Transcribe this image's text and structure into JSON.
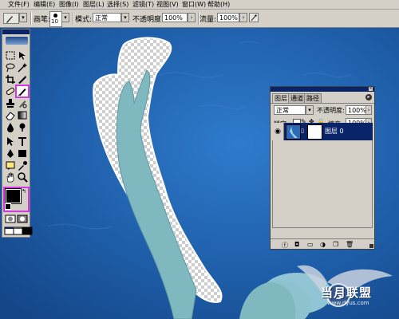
{
  "menu": {
    "items": [
      "文件(F)",
      "编辑(E)",
      "图像(I)",
      "图层(L)",
      "选择(S)",
      "滤镜(T)",
      "视图(V)",
      "窗口(W)",
      "帮助(H)"
    ]
  },
  "options": {
    "brush_label": "画笔:",
    "brush_size": "10",
    "mode_label": "模式:",
    "mode_value": "正常",
    "opacity_label": "不透明度:",
    "opacity_value": "100%",
    "flow_label": "流量:",
    "flow_value": "100%"
  },
  "layers_panel": {
    "tabs": [
      "图层",
      "通道",
      "路径"
    ],
    "blend_mode": "正常",
    "opacity_label": "不透明度:",
    "opacity_value": "100%",
    "lock_label": "锁定:",
    "fill_label": "填充:",
    "fill_value": "100%",
    "layer_name": "图层 0"
  },
  "watermark": {
    "text": "当月联盟",
    "url": "www.dyus.com"
  },
  "colors": {
    "highlight": "#d23ae0",
    "title_bar": "#0a246a",
    "panel": "#d4d0c8",
    "canvas_blue": "#1f5fa8"
  },
  "icons": [
    "brush-icon",
    "pencil-icon",
    "eyedropper-icon",
    "stamp-icon",
    "eraser-icon",
    "text-icon",
    "hand-icon",
    "zoom-icon",
    "eye-icon",
    "lock-icon",
    "link-icon",
    "trash-icon"
  ]
}
